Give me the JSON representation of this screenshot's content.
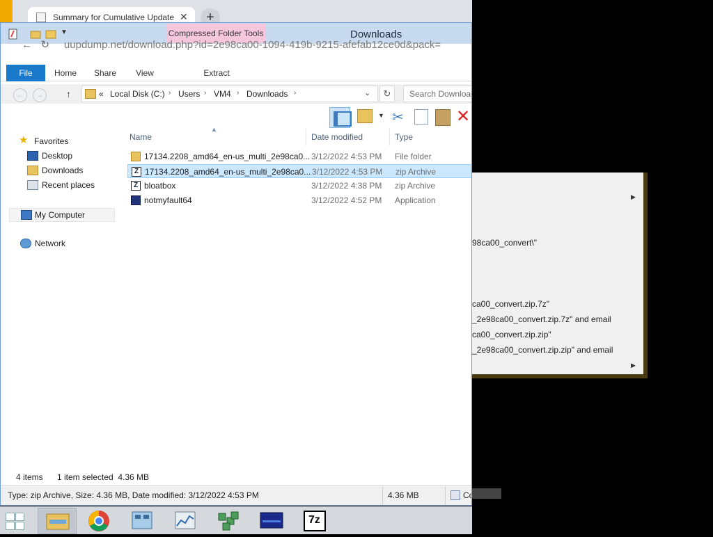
{
  "browser": {
    "tab_title": "Summary for Cumulative Update",
    "close": "✕",
    "new_tab": "+",
    "url": "uupdump.net/download.php?id=2e98ca00-1094-419b-9215-afefab12ce0d&pack="
  },
  "explorer": {
    "title": "Downloads",
    "contextual_tools": "Compressed Folder Tools",
    "ribbon_tabs": {
      "file": "File",
      "home": "Home",
      "share": "Share",
      "view": "View",
      "extract": "Extract"
    },
    "address": {
      "overflow": "«",
      "segments": [
        "Local Disk (C:)",
        "Users",
        "VM4",
        "Downloads"
      ],
      "search_placeholder": "Search Downloads"
    },
    "nav": {
      "favorites": "Favorites",
      "desktop": "Desktop",
      "downloads": "Downloads",
      "recent": "Recent places",
      "my_computer": "My Computer",
      "network": "Network"
    },
    "columns": {
      "name": "Name",
      "date": "Date modified",
      "type": "Type"
    },
    "files": [
      {
        "name": "17134.2208_amd64_en-us_multi_2e98ca0...",
        "date": "3/12/2022 4:53 PM",
        "type": "File folder",
        "icon": "folder-icon",
        "selected": false
      },
      {
        "name": "17134.2208_amd64_en-us_multi_2e98ca0...",
        "date": "3/12/2022 4:53 PM",
        "type": "zip Archive",
        "icon": "7zip-archive-icon",
        "selected": true
      },
      {
        "name": "bloatbox",
        "date": "3/12/2022 4:38 PM",
        "type": "zip Archive",
        "icon": "7zip-archive-icon",
        "selected": false
      },
      {
        "name": "notmyfault64",
        "date": "3/12/2022 4:52 PM",
        "type": "Application",
        "icon": "application-icon",
        "selected": false
      }
    ],
    "status": {
      "items": "4 items",
      "selected": "1 item selected  4.36 MB",
      "details": "Type: zip Archive, Size: 4.36 MB, Date modified: 3/12/2022 4:53 PM",
      "size": "4.36 MB",
      "computer": "Co"
    }
  },
  "context_menu": {
    "items": [
      "98ca00_convert\\\"",
      "ca00_convert.zip.7z\"",
      "_2e98ca00_convert.zip.7z\" and email",
      "ca00_convert.zip.zip\"",
      "_2e98ca00_convert.zip.zip\" and email"
    ]
  },
  "taskbar": {
    "apps": [
      "file-explorer-icon",
      "chrome-icon",
      "server-manager-icon",
      "performance-monitor-icon",
      "network-icon",
      "remote-desktop-icon",
      "7zip-icon"
    ],
    "sevenzip_label": "7z"
  },
  "colors": {
    "accent": "#1979ca",
    "selection": "#cce8ff",
    "contextual": "#f6c6dd"
  }
}
